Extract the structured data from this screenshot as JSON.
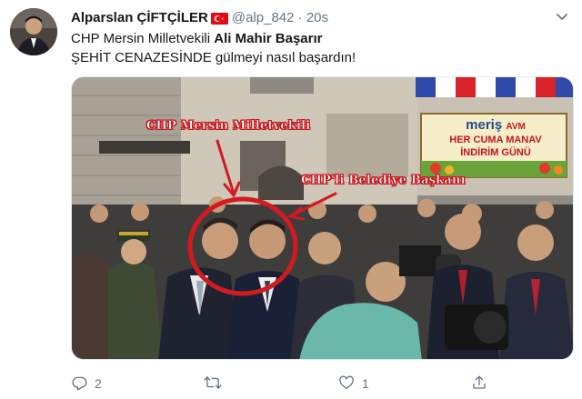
{
  "tweet": {
    "author_name": "Alparslan ÇİFTÇİLER",
    "handle": "@alp_842",
    "separator": "·",
    "time": "20s",
    "text_line1_prefix": "CHP Mersin Milletvekili ",
    "text_line1_bold": "Ali Mahir Başarır",
    "text_line2": "ŞEHİT CENAZESİNDE gülmeyi nasıl başardın!"
  },
  "media": {
    "label_mp": "CHP Mersin Milletvekili",
    "label_mayor": "CHP'li Belediye Başkanı",
    "banner_brand": "meriş",
    "banner_brand_suffix": "AVM",
    "banner_line1": "HER CUMA MANAV",
    "banner_line2": "İNDİRİM GÜNÜ"
  },
  "actions": {
    "reply_count": "2",
    "retweet_count": "",
    "like_count": "1"
  },
  "colors": {
    "text_primary": "#14171a",
    "text_secondary": "#657786",
    "annotation_red": "#c4161c",
    "flag_red": "#e30a17"
  },
  "icons": [
    "avatar",
    "turkey-flag-icon",
    "more-chevron-icon",
    "reply-icon",
    "retweet-icon",
    "like-icon",
    "share-icon"
  ]
}
